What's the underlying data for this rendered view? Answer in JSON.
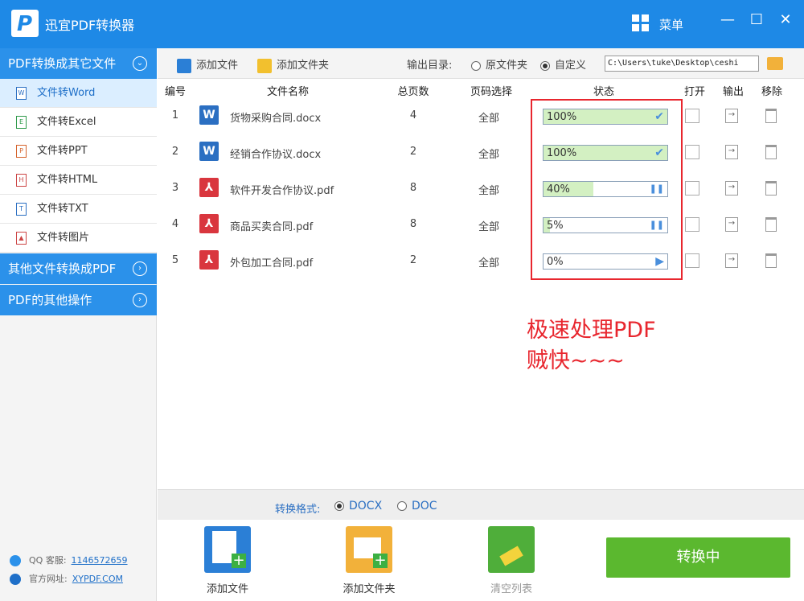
{
  "app": {
    "logo_letter": "P",
    "title": "迅宜PDF转换器",
    "menu_label": "菜单"
  },
  "window": {
    "minimize": "—",
    "maximize": "☐",
    "close": "✕"
  },
  "sidebar": {
    "categories": [
      {
        "label": "PDF转换成其它文件",
        "chevron": "⌄"
      },
      {
        "label": "其他文件转换成PDF",
        "chevron": "›"
      },
      {
        "label": "PDF的其他操作",
        "chevron": "›"
      }
    ],
    "items": [
      {
        "label": "文件转Word",
        "icon_char": "W",
        "icon_color": "#2b6fc2"
      },
      {
        "label": "文件转Excel",
        "icon_char": "E",
        "icon_color": "#2e9a4a"
      },
      {
        "label": "文件转PPT",
        "icon_char": "P",
        "icon_color": "#d5622a"
      },
      {
        "label": "文件转HTML",
        "icon_char": "H",
        "icon_color": "#c44"
      },
      {
        "label": "文件转TXT",
        "icon_char": "T",
        "icon_color": "#2b6fc2"
      },
      {
        "label": "文件转图片",
        "icon_char": "▲",
        "icon_color": "#c44"
      }
    ],
    "support": {
      "label": "QQ 客服:",
      "value": "1146572659"
    },
    "website": {
      "label": "官方网址:",
      "value": "XYPDF.COM"
    }
  },
  "toolbar": {
    "add_file": "添加文件",
    "add_folder": "添加文件夹",
    "output_label": "输出目录:",
    "option_original": "原文件夹",
    "option_custom": "自定义",
    "output_path": "C:\\Users\\tuke\\Desktop\\ceshi"
  },
  "table": {
    "headers": {
      "num": "编号",
      "name": "文件名称",
      "pages": "总页数",
      "range": "页码选择",
      "status": "状态",
      "open": "打开",
      "export": "输出",
      "remove": "移除"
    },
    "rows": [
      {
        "num": "1",
        "type": "word",
        "icon": "W",
        "name": "货物采购合同.docx",
        "pages": "4",
        "range": "全部",
        "progress": 100,
        "progress_text": "100%",
        "state_icon": "✔"
      },
      {
        "num": "2",
        "type": "word",
        "icon": "W",
        "name": "经销合作协议.docx",
        "pages": "2",
        "range": "全部",
        "progress": 100,
        "progress_text": "100%",
        "state_icon": "✔"
      },
      {
        "num": "3",
        "type": "pdf",
        "icon": "⅄",
        "name": "软件开发合作协议.pdf",
        "pages": "8",
        "range": "全部",
        "progress": 40,
        "progress_text": "40%",
        "state_icon": "❚❚"
      },
      {
        "num": "4",
        "type": "pdf",
        "icon": "⅄",
        "name": "商品买卖合同.pdf",
        "pages": "8",
        "range": "全部",
        "progress": 5,
        "progress_text": "5%",
        "state_icon": "❚❚"
      },
      {
        "num": "5",
        "type": "pdf",
        "icon": "⅄",
        "name": "外包加工合同.pdf",
        "pages": "2",
        "range": "全部",
        "progress": 0,
        "progress_text": "0%",
        "state_icon": "▶"
      }
    ]
  },
  "annotation": {
    "line1": "极速处理PDF",
    "line2": "贼快~~~"
  },
  "format": {
    "label": "转换格式:",
    "opt1": "DOCX",
    "opt2": "DOC",
    "selected": "DOCX"
  },
  "bottom": {
    "add_file": "添加文件",
    "add_folder": "添加文件夹",
    "clear_list": "清空列表",
    "convert": "转换中"
  },
  "colors": {
    "accent": "#1e89e6",
    "annotation": "#e8262e",
    "convert": "#5bb82f",
    "progress_fill": "#d3f0c2"
  }
}
